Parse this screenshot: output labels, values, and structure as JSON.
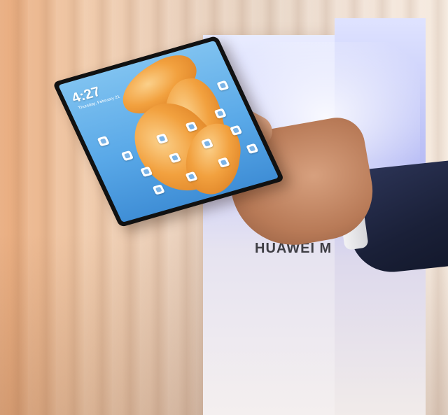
{
  "scene": {
    "description_free": true
  },
  "phone_screen": {
    "time": "4:27",
    "date": "Thursday, February 21"
  },
  "stand": {
    "brand_text": "HUAWEI M"
  },
  "colors": {
    "wallpaper_orange": "#f2a13f",
    "wallpaper_blue": "#5aa9e8",
    "curtain": "#e8d6c6",
    "sleeve": "#1a2038"
  }
}
